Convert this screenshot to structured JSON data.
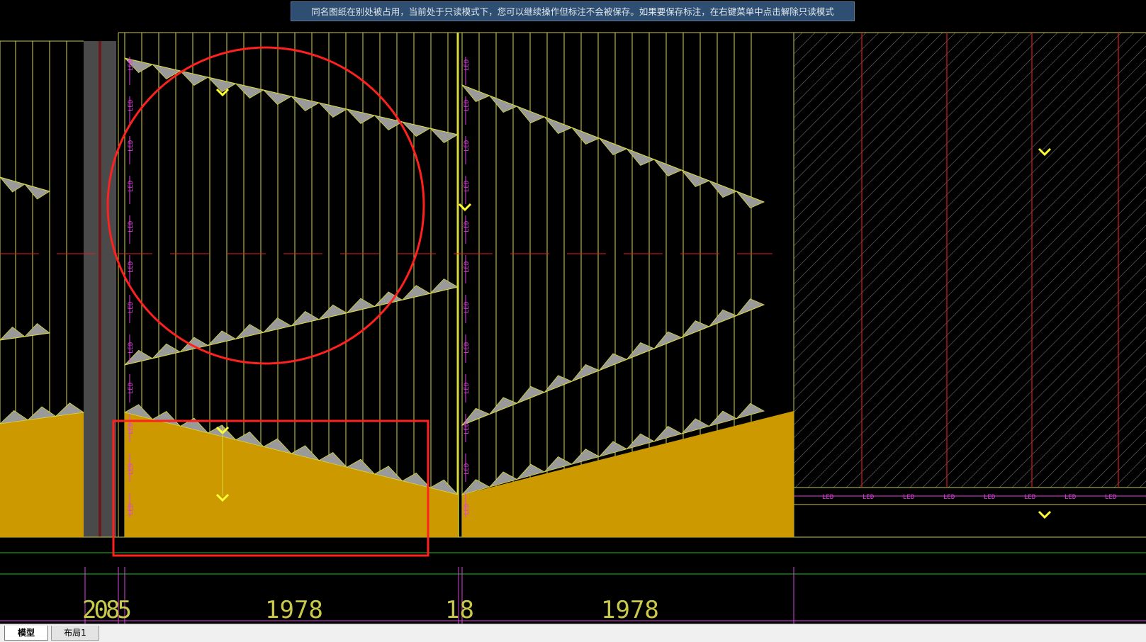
{
  "app": {
    "notice": "同名图纸在别处被占用，当前处于只读模式下，您可以继续操作但标注不会被保存。如果要保存标注，在右键菜单中点击解除只读模式"
  },
  "drawing": {
    "led_label": "LED",
    "dimensions": [
      "2085",
      "1978",
      "18",
      "1978"
    ],
    "colors": {
      "background": "#000000",
      "yellow_line": "#ffff33",
      "olive_line": "#c8c84a",
      "fill_gold": "#cc9a00",
      "gray_tri": "#9a9a9a",
      "magenta": "#e040e0",
      "red_line": "#e02020",
      "green_line": "#20c020",
      "annotation_red": "#ff2020"
    }
  },
  "tabs": [
    {
      "label": "模型",
      "active": true
    },
    {
      "label": "布局1",
      "active": false
    }
  ]
}
